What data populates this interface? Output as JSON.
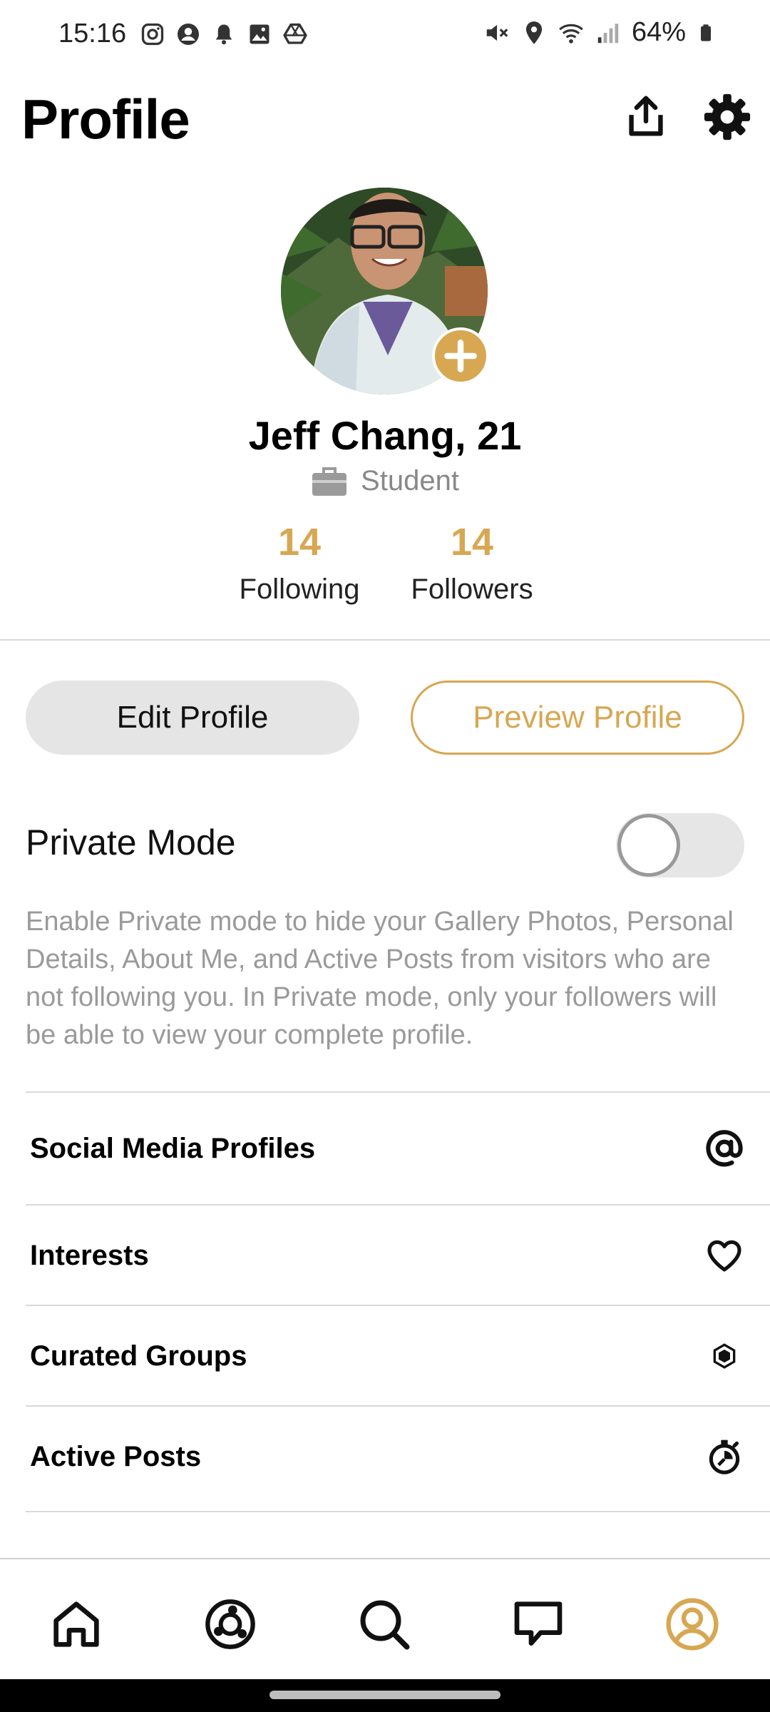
{
  "status_bar": {
    "time": "15:16",
    "battery": "64%",
    "left_icons": [
      "instagram-icon",
      "account-circle-icon",
      "bell-icon",
      "image-icon",
      "drive-icon"
    ],
    "right_icons": [
      "mute-icon",
      "location-icon",
      "wifi-icon",
      "signal-icon",
      "battery-icon"
    ]
  },
  "header": {
    "title": "Profile",
    "icons": [
      "share-icon",
      "gear-icon"
    ]
  },
  "profile": {
    "name": "Jeff Chang, 21",
    "occupation": "Student",
    "following_count": "14",
    "following_label": "Following",
    "followers_count": "14",
    "followers_label": "Followers"
  },
  "actions": {
    "edit_label": "Edit Profile",
    "preview_label": "Preview Profile"
  },
  "private_mode": {
    "label": "Private Mode",
    "enabled": false,
    "description": "Enable Private mode to hide your Gallery Photos, Personal Details, About Me, and Active Posts from visitors who are not following you. In Private mode, only your followers will be able to view your complete profile."
  },
  "menu": [
    {
      "label": "Social Media Profiles",
      "icon": "at-icon"
    },
    {
      "label": "Interests",
      "icon": "heart-icon"
    },
    {
      "label": "Curated Groups",
      "icon": "hexagon-icon"
    },
    {
      "label": "Active Posts",
      "icon": "stopwatch-icon"
    }
  ],
  "bottom_nav": {
    "items": [
      "home-icon",
      "explore-icon",
      "search-icon",
      "chat-icon",
      "profile-icon"
    ],
    "active": "profile-icon"
  },
  "colors": {
    "accent": "#d7a752",
    "muted_text": "#9a9a9a",
    "divider": "#d9d9d9"
  }
}
